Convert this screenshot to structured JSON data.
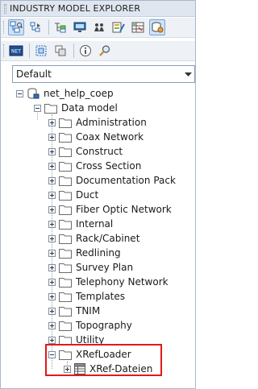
{
  "panel": {
    "title": "INDUSTRY MODEL EXPLORER"
  },
  "toolbar1": {
    "buttons": [
      {
        "icon": "tree-view-icon",
        "active": true
      },
      {
        "icon": "navigate-back-icon",
        "active": false
      },
      {
        "icon": "filter-icon",
        "active": false
      },
      {
        "icon": "monitor-icon",
        "active": false
      },
      {
        "icon": "users-icon",
        "active": false
      },
      {
        "icon": "form-edit-icon",
        "active": false
      },
      {
        "icon": "table-icon",
        "active": false
      },
      {
        "icon": "database-settings-icon",
        "active": true
      }
    ]
  },
  "toolbar2": {
    "buttons": [
      {
        "icon": "net-icon",
        "label": "NET"
      },
      {
        "icon": "select-area-icon"
      },
      {
        "icon": "copy-icon"
      },
      {
        "icon": "info-icon"
      },
      {
        "icon": "search-icon"
      }
    ]
  },
  "combo": {
    "value": "Default"
  },
  "tree": {
    "root": {
      "label": "net_help_coep"
    },
    "data_model": {
      "label": "Data model"
    },
    "items": [
      {
        "label": "Administration"
      },
      {
        "label": "Coax Network"
      },
      {
        "label": "Construct"
      },
      {
        "label": "Cross Section"
      },
      {
        "label": "Documentation Pack"
      },
      {
        "label": "Duct"
      },
      {
        "label": "Fiber Optic Network"
      },
      {
        "label": "Internal"
      },
      {
        "label": "Rack/Cabinet"
      },
      {
        "label": "Redlining"
      },
      {
        "label": "Survey Plan"
      },
      {
        "label": "Telephony Network"
      },
      {
        "label": "Templates"
      },
      {
        "label": "TNIM"
      },
      {
        "label": "Topography"
      },
      {
        "label": "Utility"
      }
    ],
    "xref": {
      "label": "XRefLoader"
    },
    "xref_child": {
      "label": "XRef-Dateien"
    }
  },
  "colors": {
    "highlight": "#e01a1a",
    "folder_fill": "#ffffff",
    "folder_stroke": "#6b6b6b",
    "accent": "#2f6fb5"
  }
}
